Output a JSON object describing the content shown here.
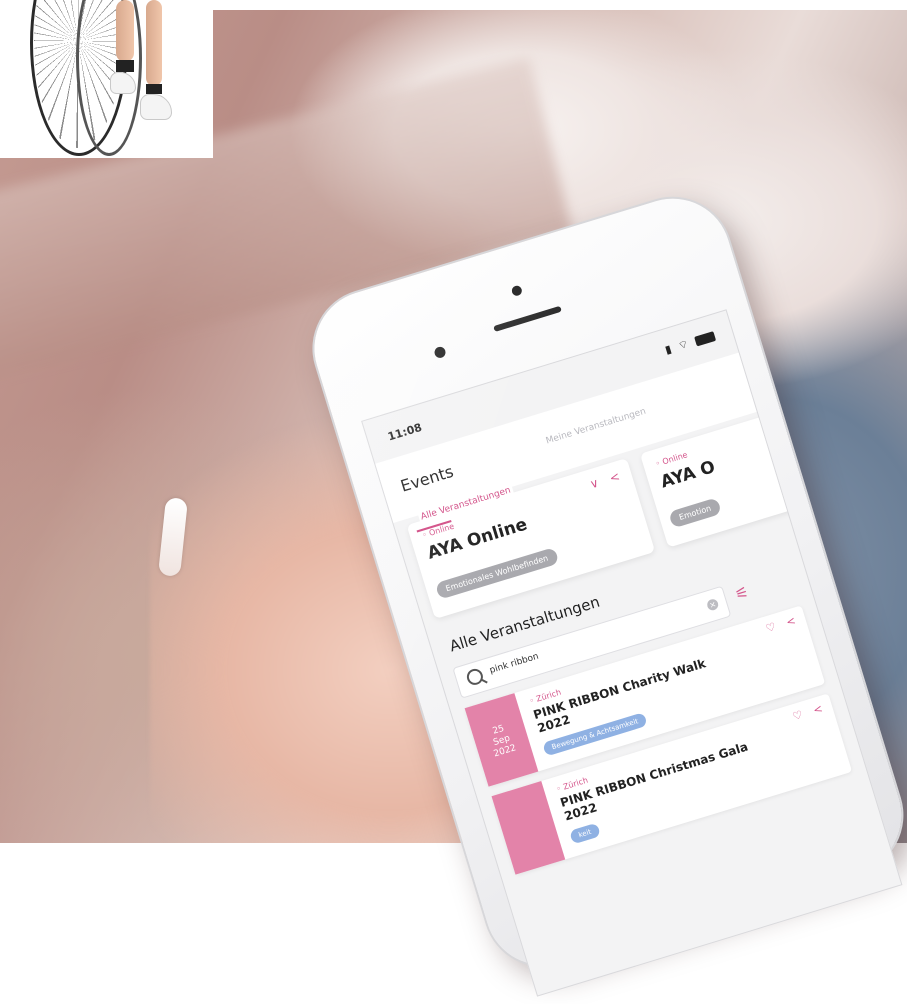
{
  "phone": {
    "status_time": "11:08",
    "app": {
      "page_title": "Events",
      "tabs": [
        {
          "label": "Alle Veranstaltungen",
          "active": true
        },
        {
          "label": "Meine Veranstaltungen",
          "active": false
        }
      ],
      "featured_cards": [
        {
          "location": "Online",
          "title": "AYA Online",
          "tag": "Emotionales Wohlbefinden"
        },
        {
          "location": "Online",
          "title": "AYA O",
          "tag": "Emotion"
        }
      ],
      "section_title": "Alle Veranstaltungen",
      "search": {
        "value": "pink ribbon"
      },
      "events": [
        {
          "date_day": "25",
          "date_month": "Sep",
          "date_year": "2022",
          "location": "Zürich",
          "title": "PINK RIBBON Charity Walk 2022",
          "tag": "Bewegung & Achtsamkeit"
        },
        {
          "date_day": "",
          "date_month": "",
          "date_year": "",
          "location": "Zürich",
          "title": "PINK RIBBON Christmas Gala 2022",
          "tag": "keit"
        }
      ]
    }
  },
  "colors": {
    "accent": "#d4568c",
    "date_block": "#e383a9",
    "tag_blue": "#8fb1e3",
    "tag_grey": "#a9a9ae"
  },
  "icons": [
    "heart-icon",
    "share-icon",
    "chevron-down-icon",
    "search-icon",
    "clear-icon",
    "filter-icon",
    "location-pin-icon"
  ]
}
